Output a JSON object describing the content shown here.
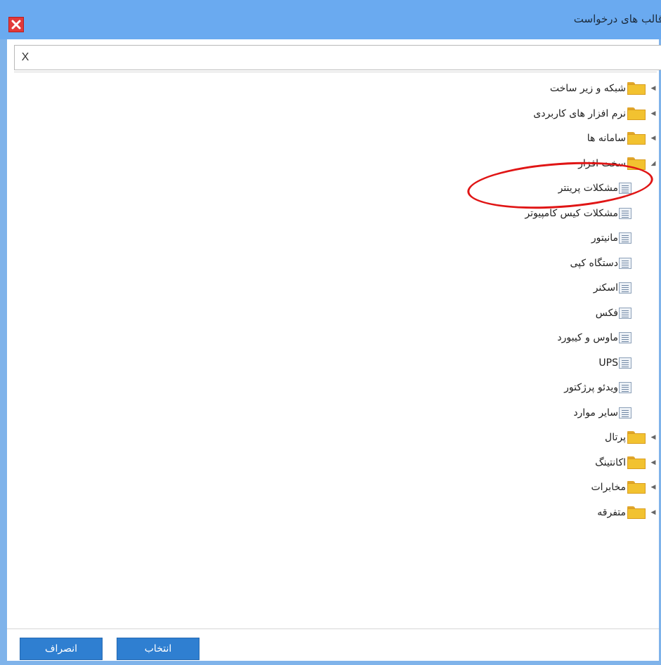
{
  "window": {
    "title": "قالب های درخواست",
    "close_icon": "close-icon",
    "accent_color": "#6aaaf0",
    "close_color": "#e23a3a"
  },
  "search": {
    "clear_label": "X",
    "value": "",
    "placeholder": ""
  },
  "tree": {
    "folders_top": [
      {
        "label": "شبکه و زیر ساخت",
        "expanded": false
      },
      {
        "label": "نرم افزار های کاربردی",
        "expanded": false
      },
      {
        "label": "سامانه ها",
        "expanded": false
      },
      {
        "label": "سخت افزار",
        "expanded": true
      }
    ],
    "children": [
      {
        "label": "مشکلات پرینتر"
      },
      {
        "label": "مشکلات کیس کامپیوتر"
      },
      {
        "label": "مانیتور"
      },
      {
        "label": "دستگاه کپی"
      },
      {
        "label": "اسکنر"
      },
      {
        "label": "فکس"
      },
      {
        "label": "ماوس و کیبورد"
      },
      {
        "label": "UPS"
      },
      {
        "label": "ویدئو پرژکتور"
      },
      {
        "label": "سایر موارد"
      }
    ],
    "folders_bottom": [
      {
        "label": "پرتال",
        "expanded": false
      },
      {
        "label": "اکانتینگ",
        "expanded": false
      },
      {
        "label": "مخابرات",
        "expanded": false
      },
      {
        "label": "متفرقه",
        "expanded": false
      }
    ],
    "folder_icon": "folder-icon",
    "document_icon": "document-icon"
  },
  "footer": {
    "cancel_label": "انصراف",
    "select_label": "انتخاب",
    "button_color": "#2f7fd1"
  }
}
